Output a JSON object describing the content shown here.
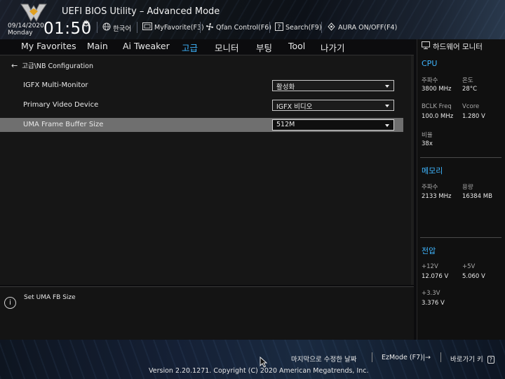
{
  "header": {
    "app_title": "UEFI BIOS Utility – Advanced Mode",
    "date": "09/14/2020",
    "day": "Monday",
    "time": "01:50",
    "toolbar": [
      {
        "label": "한국어",
        "icon": "globe-icon"
      },
      {
        "label": "MyFavorite(F3)",
        "icon": "favorite-icon"
      },
      {
        "label": "Qfan Control(F6)",
        "icon": "fan-icon"
      },
      {
        "label": "Search(F9)",
        "icon": "search-icon"
      },
      {
        "label": "AURA ON/OFF(F4)",
        "icon": "aura-icon"
      }
    ]
  },
  "menu": {
    "tabs": [
      "My Favorites",
      "Main",
      "Ai Tweaker",
      "고급",
      "모니터",
      "부팅",
      "Tool",
      "나가기"
    ],
    "active_tab": "고급"
  },
  "main": {
    "breadcrumb": "고급\\NB Configuration",
    "settings": [
      {
        "label": "IGFX Multi-Monitor",
        "value": "활성화"
      },
      {
        "label": "Primary Video Device",
        "value": "IGFX 비디오"
      },
      {
        "label": "UMA Frame Buffer Size",
        "value": "512M"
      }
    ],
    "selected_index": 2
  },
  "info": {
    "text": "Set UMA FB Size"
  },
  "hw_monitor": {
    "title": "하드웨어 모니터",
    "cpu": {
      "section": "CPU",
      "freq_label": "주파수",
      "freq_value": "3800 MHz",
      "temp_label": "온도",
      "temp_value": "28°C",
      "bclk_label": "BCLK Freq",
      "bclk_value": "100.0 MHz",
      "vcore_label": "Vcore",
      "vcore_value": "1.280 V",
      "ratio_label": "비율",
      "ratio_value": "38x"
    },
    "memory": {
      "section": "메모리",
      "freq_label": "주파수",
      "freq_value": "2133 MHz",
      "cap_label": "용량",
      "cap_value": "16384 MB"
    },
    "voltage": {
      "section": "전압",
      "v12_label": "+12V",
      "v12_value": "12.076 V",
      "v5_label": "+5V",
      "v5_value": "5.060 V",
      "v33_label": "+3.3V",
      "v33_value": "3.376 V"
    }
  },
  "footer": {
    "last_modified": "마지막으로 수정한 날짜",
    "ezmode": "EzMode (F7)|→",
    "hotkeys": "바로가기 키",
    "copyright": "Version 2.20.1271. Copyright (C) 2020 American Megatrends, Inc."
  },
  "colors": {
    "accent": "#3fb6ff",
    "selected_row": "#6f6f6f"
  }
}
